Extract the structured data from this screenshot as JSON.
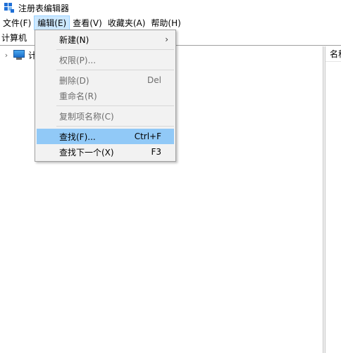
{
  "window": {
    "title": "注册表编辑器",
    "icon": "registry-editor-icon"
  },
  "menubar": {
    "items": [
      {
        "label": "文件(F)"
      },
      {
        "label": "编辑(E)"
      },
      {
        "label": "查看(V)"
      },
      {
        "label": "收藏夹(A)"
      },
      {
        "label": "帮助(H)"
      }
    ],
    "active_index": 1
  },
  "address": {
    "path": "计算机"
  },
  "tree": {
    "root_label": "计",
    "icon": "computer-icon",
    "expand_icon": "chevron-right-icon"
  },
  "list": {
    "column_name": "名称"
  },
  "edit_menu": {
    "items": [
      {
        "label": "新建(N)",
        "shortcut": "",
        "submenu_arrow": "›",
        "disabled": false,
        "highlighted": false
      },
      {
        "label": "权限(P)...",
        "shortcut": "",
        "disabled": true,
        "highlighted": false
      },
      {
        "label": "删除(D)",
        "shortcut": "Del",
        "disabled": true,
        "highlighted": false
      },
      {
        "label": "重命名(R)",
        "shortcut": "",
        "disabled": true,
        "highlighted": false
      },
      {
        "label": "复制项名称(C)",
        "shortcut": "",
        "disabled": true,
        "highlighted": false
      },
      {
        "label": "查找(F)...",
        "shortcut": "Ctrl+F",
        "disabled": false,
        "highlighted": true
      },
      {
        "label": "查找下一个(X)",
        "shortcut": "F3",
        "disabled": false,
        "highlighted": false
      }
    ]
  }
}
